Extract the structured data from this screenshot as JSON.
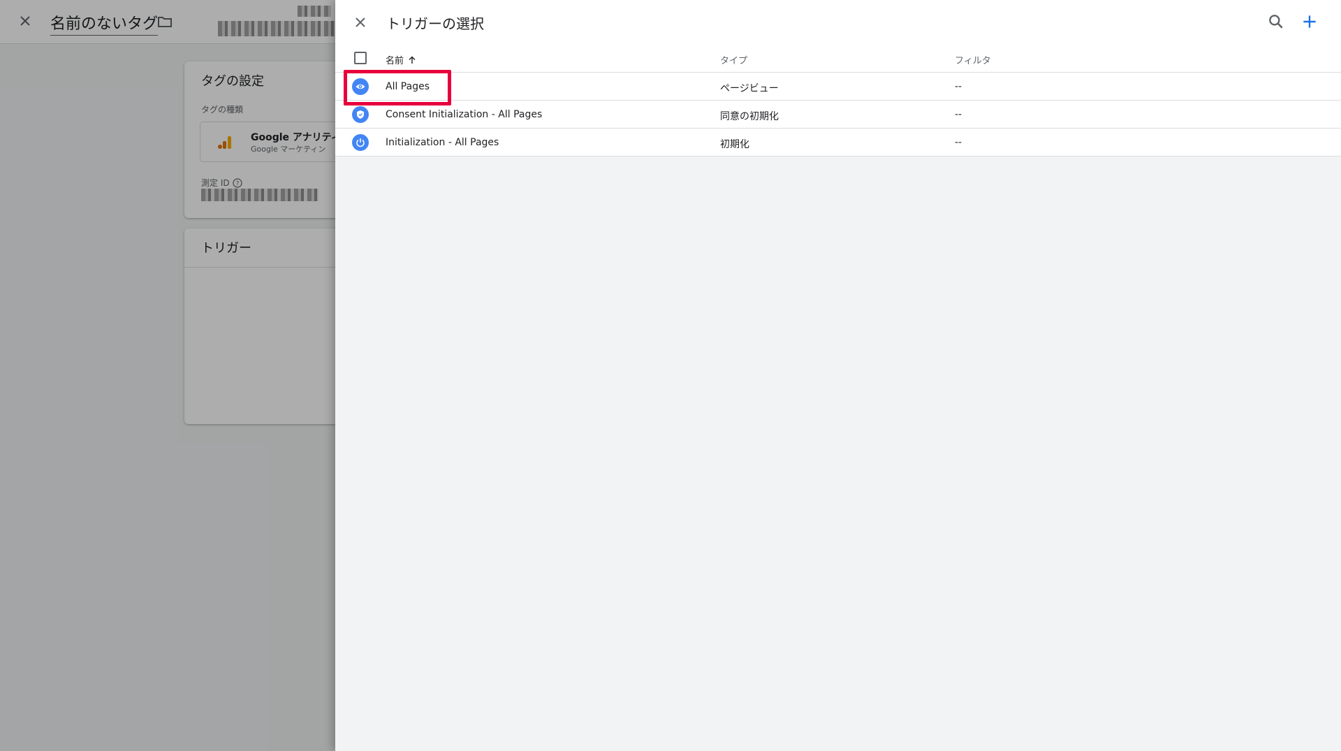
{
  "background": {
    "title": "名前のないタグ",
    "tag_settings": {
      "heading": "タグの設定",
      "type_label": "タグの種類",
      "tag_type_name": "Google アナリティ",
      "tag_type_desc": "Google マーケティン",
      "measurement_id_label": "測定 ID"
    },
    "triggers_heading": "トリガー"
  },
  "panel": {
    "title": "トリガーの選択",
    "columns": {
      "name": "名前",
      "type": "タイプ",
      "filter": "フィルタ"
    },
    "rows": [
      {
        "name": "All Pages",
        "type": "ページビュー",
        "filter": "--",
        "icon": "eye-icon"
      },
      {
        "name": "Consent Initialization - All Pages",
        "type": "同意の初期化",
        "filter": "--",
        "icon": "shield-icon"
      },
      {
        "name": "Initialization - All Pages",
        "type": "初期化",
        "filter": "--",
        "icon": "power-icon"
      }
    ]
  },
  "colors": {
    "accent": "#4285f4",
    "add": "#1a73e8",
    "highlight": "#e8003d"
  }
}
